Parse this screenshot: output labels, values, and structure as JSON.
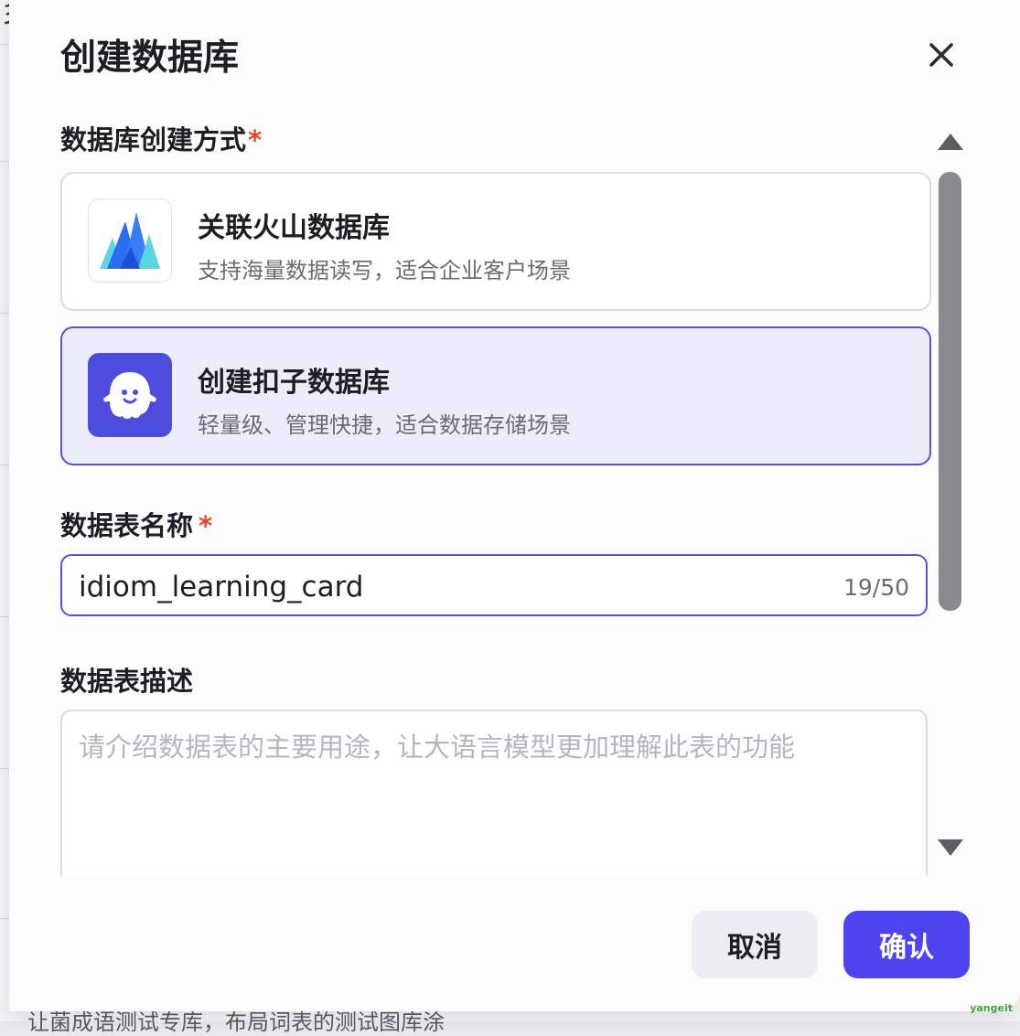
{
  "dialog": {
    "title": "创建数据库",
    "close_icon": "close-icon"
  },
  "creation_method": {
    "label": "数据库创建方式",
    "required_mark": "*",
    "options": [
      {
        "title": "关联火山数据库",
        "description": "支持海量数据读写，适合企业客户场景",
        "icon": "volcano-mountain-icon",
        "selected": false
      },
      {
        "title": "创建扣子数据库",
        "description": "轻量级、管理快捷，适合数据存储场景",
        "icon": "coze-ghost-icon",
        "selected": true
      }
    ]
  },
  "table_name": {
    "label": "数据表名称",
    "required_mark": "*",
    "value": "idiom_learning_card",
    "counter": "19/50"
  },
  "table_description": {
    "label": "数据表描述",
    "placeholder": "请介绍数据表的主要用途，让大语言模型更加理解此表的功能"
  },
  "footer": {
    "cancel_label": "取消",
    "confirm_label": "确认"
  },
  "background": {
    "corner_glyph": "彡",
    "bottom_text": "让菌成语测试专库，布局词表的测试图库涂"
  },
  "watermark": "yangeit",
  "colors": {
    "accent": "#4d44f0",
    "selected_card_bg": "#ecedfb",
    "required": "#e5472b"
  }
}
